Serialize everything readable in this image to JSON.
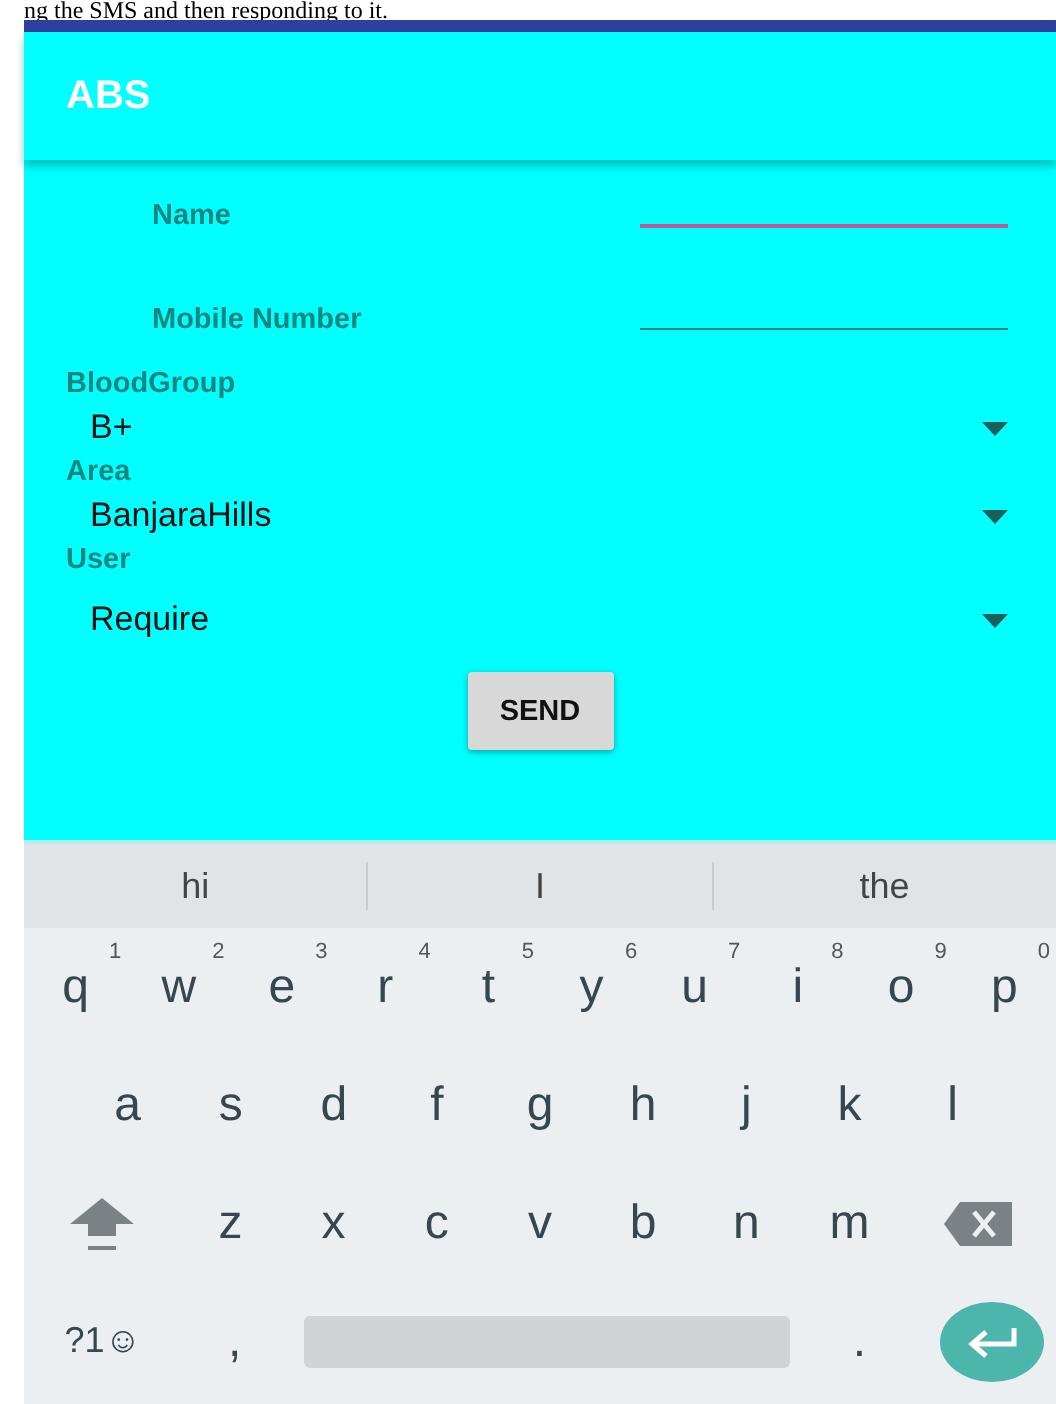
{
  "caption": "ng the SMS and then responding to it.",
  "app_bar": {
    "title": "ABS"
  },
  "text_fields": [
    {
      "label": "Name",
      "focused": true
    },
    {
      "label": "Mobile Number",
      "focused": false
    }
  ],
  "spinners": [
    {
      "label": "BloodGroup",
      "value": "B+"
    },
    {
      "label": "Area",
      "value": "BanjaraHills"
    },
    {
      "label": "User",
      "value": "Require"
    }
  ],
  "send_button": "SEND",
  "keyboard": {
    "suggestions": [
      "hi",
      "I",
      "the"
    ],
    "rows": [
      [
        {
          "kind": "letter",
          "label": "q",
          "hint": "1"
        },
        {
          "kind": "letter",
          "label": "w",
          "hint": "2"
        },
        {
          "kind": "letter",
          "label": "e",
          "hint": "3"
        },
        {
          "kind": "letter",
          "label": "r",
          "hint": "4"
        },
        {
          "kind": "letter",
          "label": "t",
          "hint": "5"
        },
        {
          "kind": "letter",
          "label": "y",
          "hint": "6"
        },
        {
          "kind": "letter",
          "label": "u",
          "hint": "7"
        },
        {
          "kind": "letter",
          "label": "i",
          "hint": "8"
        },
        {
          "kind": "letter",
          "label": "o",
          "hint": "9"
        },
        {
          "kind": "letter",
          "label": "p",
          "hint": "0"
        }
      ],
      [
        {
          "kind": "letter",
          "label": "a"
        },
        {
          "kind": "letter",
          "label": "s"
        },
        {
          "kind": "letter",
          "label": "d"
        },
        {
          "kind": "letter",
          "label": "f"
        },
        {
          "kind": "letter",
          "label": "g"
        },
        {
          "kind": "letter",
          "label": "h"
        },
        {
          "kind": "letter",
          "label": "j"
        },
        {
          "kind": "letter",
          "label": "k"
        },
        {
          "kind": "letter",
          "label": "l"
        }
      ],
      [
        {
          "kind": "shift"
        },
        {
          "kind": "letter",
          "label": "z"
        },
        {
          "kind": "letter",
          "label": "x"
        },
        {
          "kind": "letter",
          "label": "c"
        },
        {
          "kind": "letter",
          "label": "v"
        },
        {
          "kind": "letter",
          "label": "b"
        },
        {
          "kind": "letter",
          "label": "n"
        },
        {
          "kind": "letter",
          "label": "m"
        },
        {
          "kind": "backspace"
        }
      ]
    ],
    "bottom_row": [
      {
        "kind": "symbols",
        "label": "?1☺"
      },
      {
        "kind": "letter",
        "label": ","
      },
      {
        "kind": "space"
      },
      {
        "kind": "letter",
        "label": "."
      },
      {
        "kind": "enter"
      }
    ]
  }
}
